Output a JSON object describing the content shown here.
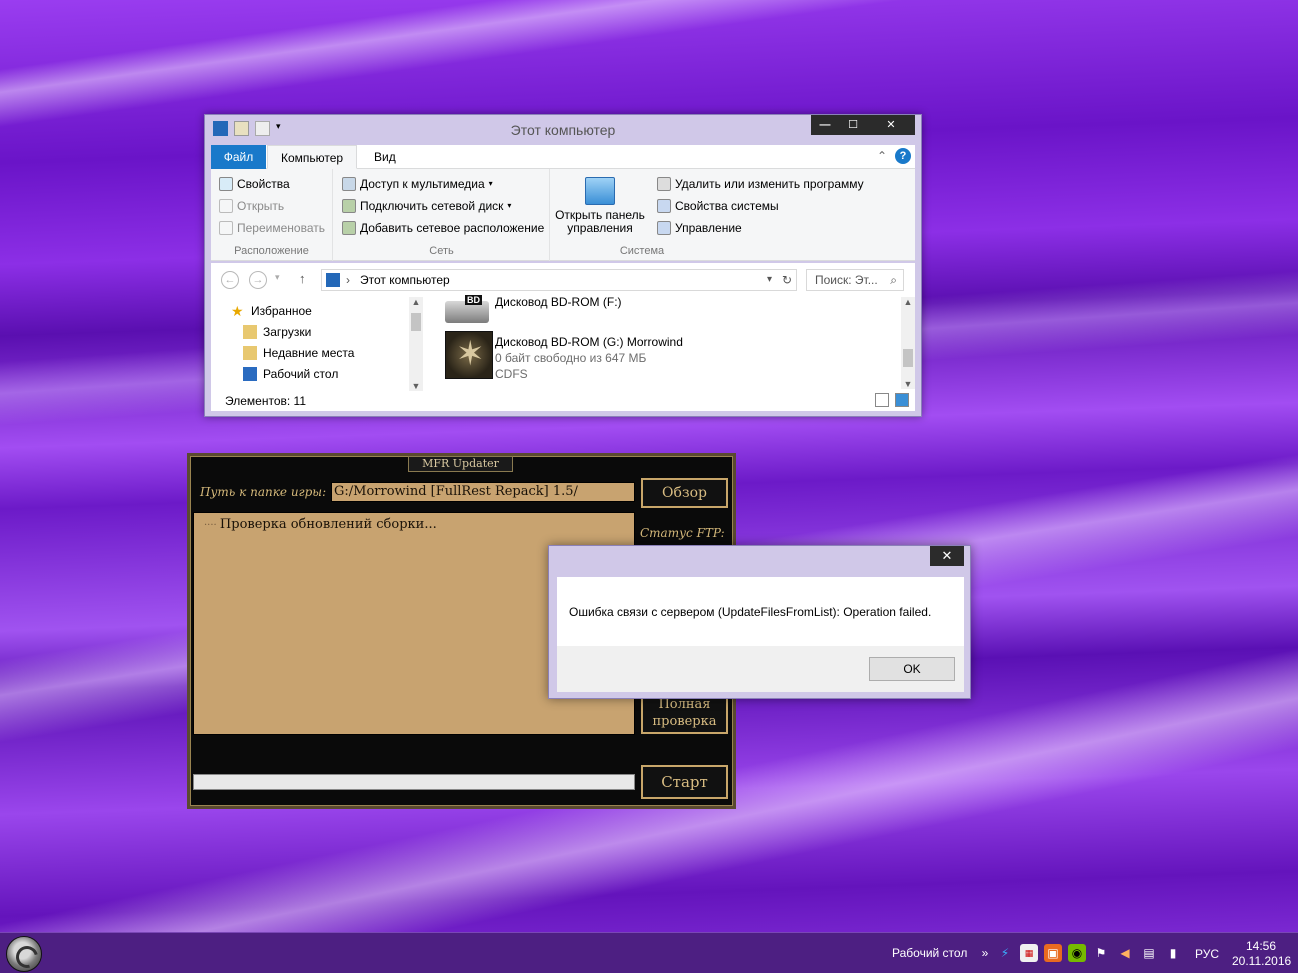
{
  "explorer": {
    "title": "Этот компьютер",
    "tabs": {
      "file": "Файл",
      "computer": "Компьютер",
      "view": "Вид"
    },
    "ribbon": {
      "location": {
        "label": "Расположение",
        "properties": "Свойства",
        "open": "Открыть",
        "rename": "Переименовать"
      },
      "network": {
        "label": "Сеть",
        "media_access": "Доступ к мультимедиа",
        "map_drive": "Подключить сетевой диск",
        "add_location": "Добавить сетевое расположение"
      },
      "control_panel": "Открыть панель управления",
      "system": {
        "label": "Система",
        "uninstall": "Удалить или изменить программу",
        "properties": "Свойства системы",
        "manage": "Управление"
      }
    },
    "address": {
      "path": "Этот компьютер",
      "search_placeholder": "Поиск: Эт..."
    },
    "nav": {
      "favorites": "Избранное",
      "downloads": "Загрузки",
      "recent": "Недавние места",
      "desktop": "Рабочий стол"
    },
    "drives": [
      {
        "name": "Дисковод BD-ROM (F:)"
      },
      {
        "name": "Дисковод BD-ROM (G:) Morrowind",
        "free": "0 байт свободно из 647 МБ",
        "fs": "CDFS"
      }
    ],
    "bd_badge": "BD",
    "status": "Элементов: 11"
  },
  "mfr": {
    "title": "MFR Updater",
    "path_label": "Путь к папке игры:",
    "path_value": "G:/Morrowind [FullRest Repack] 1.5/",
    "browse": "Обзор",
    "log_line": "Проверка обновлений сборки...",
    "ftp_status": "Статус FTP:",
    "full_check": "Полная проверка",
    "start": "Старт"
  },
  "dialog": {
    "message": "Ошибка связи с сервером (UpdateFilesFromList): Operation failed.",
    "ok": "OK"
  },
  "taskbar": {
    "desktop": "Рабочий стол",
    "lang": "РУС",
    "time": "14:56",
    "date": "20.11.2016"
  }
}
